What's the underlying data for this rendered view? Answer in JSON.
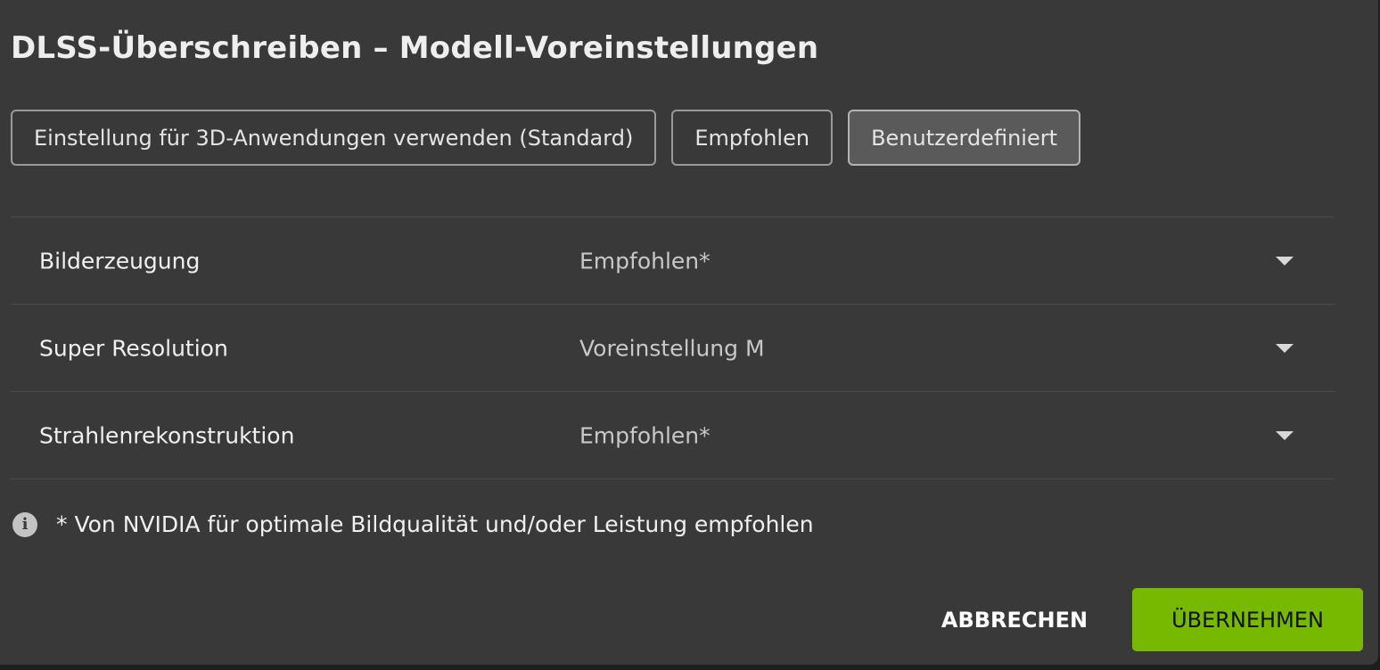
{
  "dialog": {
    "title": "DLSS-Überschreiben – Modell-Voreinstellungen"
  },
  "presets": [
    {
      "label": "Einstellung für 3D-Anwendungen verwenden (Standard)",
      "selected": false
    },
    {
      "label": "Empfohlen",
      "selected": false
    },
    {
      "label": "Benutzerdefiniert",
      "selected": true
    }
  ],
  "settings": [
    {
      "label": "Bilderzeugung",
      "value": "Empfohlen*"
    },
    {
      "label": "Super Resolution",
      "value": "Voreinstellung M"
    },
    {
      "label": "Strahlenrekonstruktion",
      "value": "Empfohlen*"
    }
  ],
  "note": {
    "icon": "info-icon",
    "icon_glyph": "i",
    "text": "* Von NVIDIA für optimale Bildqualität und/oder Leistung empfohlen"
  },
  "actions": {
    "cancel_label": "ABBRECHEN",
    "apply_label": "ÜBERNEHMEN"
  },
  "colors": {
    "background": "#393939",
    "accent": "#76b900",
    "selected_button": "#5a5a5a"
  }
}
